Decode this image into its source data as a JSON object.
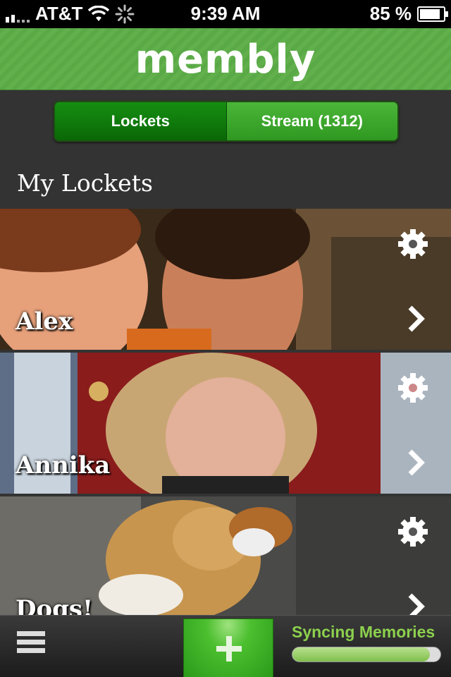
{
  "status_bar": {
    "carrier": "AT&T",
    "time": "9:39 AM",
    "battery": "85 %"
  },
  "header": {
    "logo": "membly"
  },
  "tabs": [
    {
      "label": "Lockets",
      "active": true
    },
    {
      "label": "Stream (1312)",
      "active": false
    }
  ],
  "section_title": "My Lockets",
  "lockets": [
    {
      "name": "Alex"
    },
    {
      "name": "Annika"
    },
    {
      "name": "Dogs!"
    }
  ],
  "bottom_bar": {
    "sync_label": "Syncing Memories",
    "sync_progress": 0.93
  },
  "colors": {
    "brand_green": "#5aa947",
    "sync_text": "#8cd04d"
  }
}
